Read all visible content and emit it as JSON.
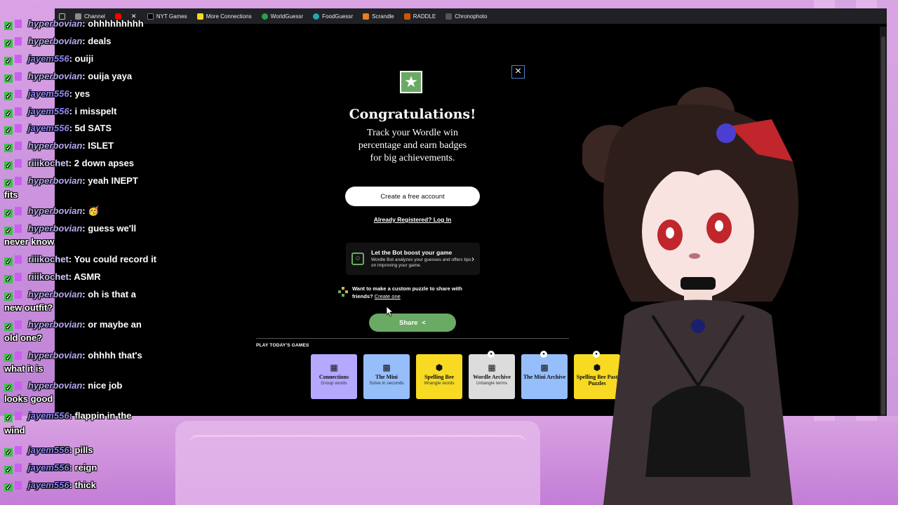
{
  "bookmarks": [
    {
      "label": "",
      "icon": "apps-grid-icon"
    },
    {
      "label": "Channel",
      "icon": "folder-icon"
    },
    {
      "label": "",
      "icon": "youtube-icon"
    },
    {
      "label": "",
      "icon": "x-icon"
    },
    {
      "label": "NYT Games",
      "icon": "nyt-icon"
    },
    {
      "label": "More Connections",
      "icon": "grid-icon"
    },
    {
      "label": "WorldGuessr",
      "icon": "globe-icon"
    },
    {
      "label": "FoodGuessr",
      "icon": "food-icon"
    },
    {
      "label": "Scrandle",
      "icon": "scrandle-icon"
    },
    {
      "label": "RADDLE",
      "icon": "raddle-icon"
    },
    {
      "label": "Chronophoto",
      "icon": "chronophoto-icon"
    }
  ],
  "modal": {
    "title": "Congratulations!",
    "subtitle": "Track your Wordle win percentage and earn badges for big achievements.",
    "create_account": "Create a free account",
    "login": "Already Registered? Log In",
    "bot_title": "Let the Bot boost your game",
    "bot_desc": "Wordle Bot analyzes your guesses and offers tips on improving your game.",
    "custom_text": "Want to make a custom puzzle to share with friends?",
    "custom_link": "Create one",
    "share": "Share",
    "games_label": "PLAY TODAY'S GAMES"
  },
  "games": [
    {
      "name": "Connections",
      "sub": "Group words",
      "color": "#b4a8ff"
    },
    {
      "name": "The Mini",
      "sub": "Solve in seconds",
      "color": "#95befa"
    },
    {
      "name": "Spelling Bee",
      "sub": "Wrangle words",
      "color": "#f7da21"
    },
    {
      "name": "Wordle Archive",
      "sub": "Untangle terms",
      "color": "#dcdcdc"
    },
    {
      "name": "The Mini Archive",
      "sub": "",
      "color": "#95befa"
    },
    {
      "name": "Spelling Bee Past Puzzles",
      "sub": "",
      "color": "#f7da21"
    }
  ],
  "chat": [
    {
      "user": "hyperbovian",
      "msg": "ohhhhhhhhh"
    },
    {
      "user": "hyperbovian",
      "msg": "deals"
    },
    {
      "user": "jayem556",
      "msg": "ouiji"
    },
    {
      "user": "hyperbovian",
      "msg": "ouija yaya"
    },
    {
      "user": "jayem556",
      "msg": "yes"
    },
    {
      "user": "jayem556",
      "msg": "i misspelt"
    },
    {
      "user": "jayem556",
      "msg": "5d SATS"
    },
    {
      "user": "hyperbovian",
      "msg": "ISLET"
    },
    {
      "user": "riiikochet",
      "msg": "2 down apses"
    },
    {
      "user": "hyperbovian",
      "msg": "yeah INEPT"
    },
    {
      "user": "",
      "msg": "fits"
    },
    {
      "user": "hyperbovian",
      "msg": "🥳"
    },
    {
      "user": "hyperbovian",
      "msg": "guess we'll"
    },
    {
      "user": "",
      "msg": "never know"
    },
    {
      "user": "riiikochet",
      "msg": "You could record it"
    },
    {
      "user": "riiikochet",
      "msg": "ASMR"
    },
    {
      "user": "hyperbovian",
      "msg": "oh is that a"
    },
    {
      "user": "",
      "msg": "new outfit?"
    },
    {
      "user": "hyperbovian",
      "msg": "or maybe an"
    },
    {
      "user": "",
      "msg": "old one?"
    },
    {
      "user": "hyperbovian",
      "msg": "ohhhh that's"
    },
    {
      "user": "",
      "msg": "what it is"
    },
    {
      "user": "hyperbovian",
      "msg": "nice job"
    },
    {
      "user": "",
      "msg": "looks good"
    },
    {
      "user": "jayem556",
      "msg": "flappin in the"
    },
    {
      "user": "",
      "msg": "wind"
    },
    {
      "user": "jayem556",
      "msg": "pills"
    },
    {
      "user": "jayem556",
      "msg": "reign"
    },
    {
      "user": "jayem556",
      "msg": "thick"
    }
  ],
  "colors": {
    "wordle_green": "#6aaa64",
    "wordle_yellow": "#c9b458",
    "close_border": "#4a7fd1"
  }
}
